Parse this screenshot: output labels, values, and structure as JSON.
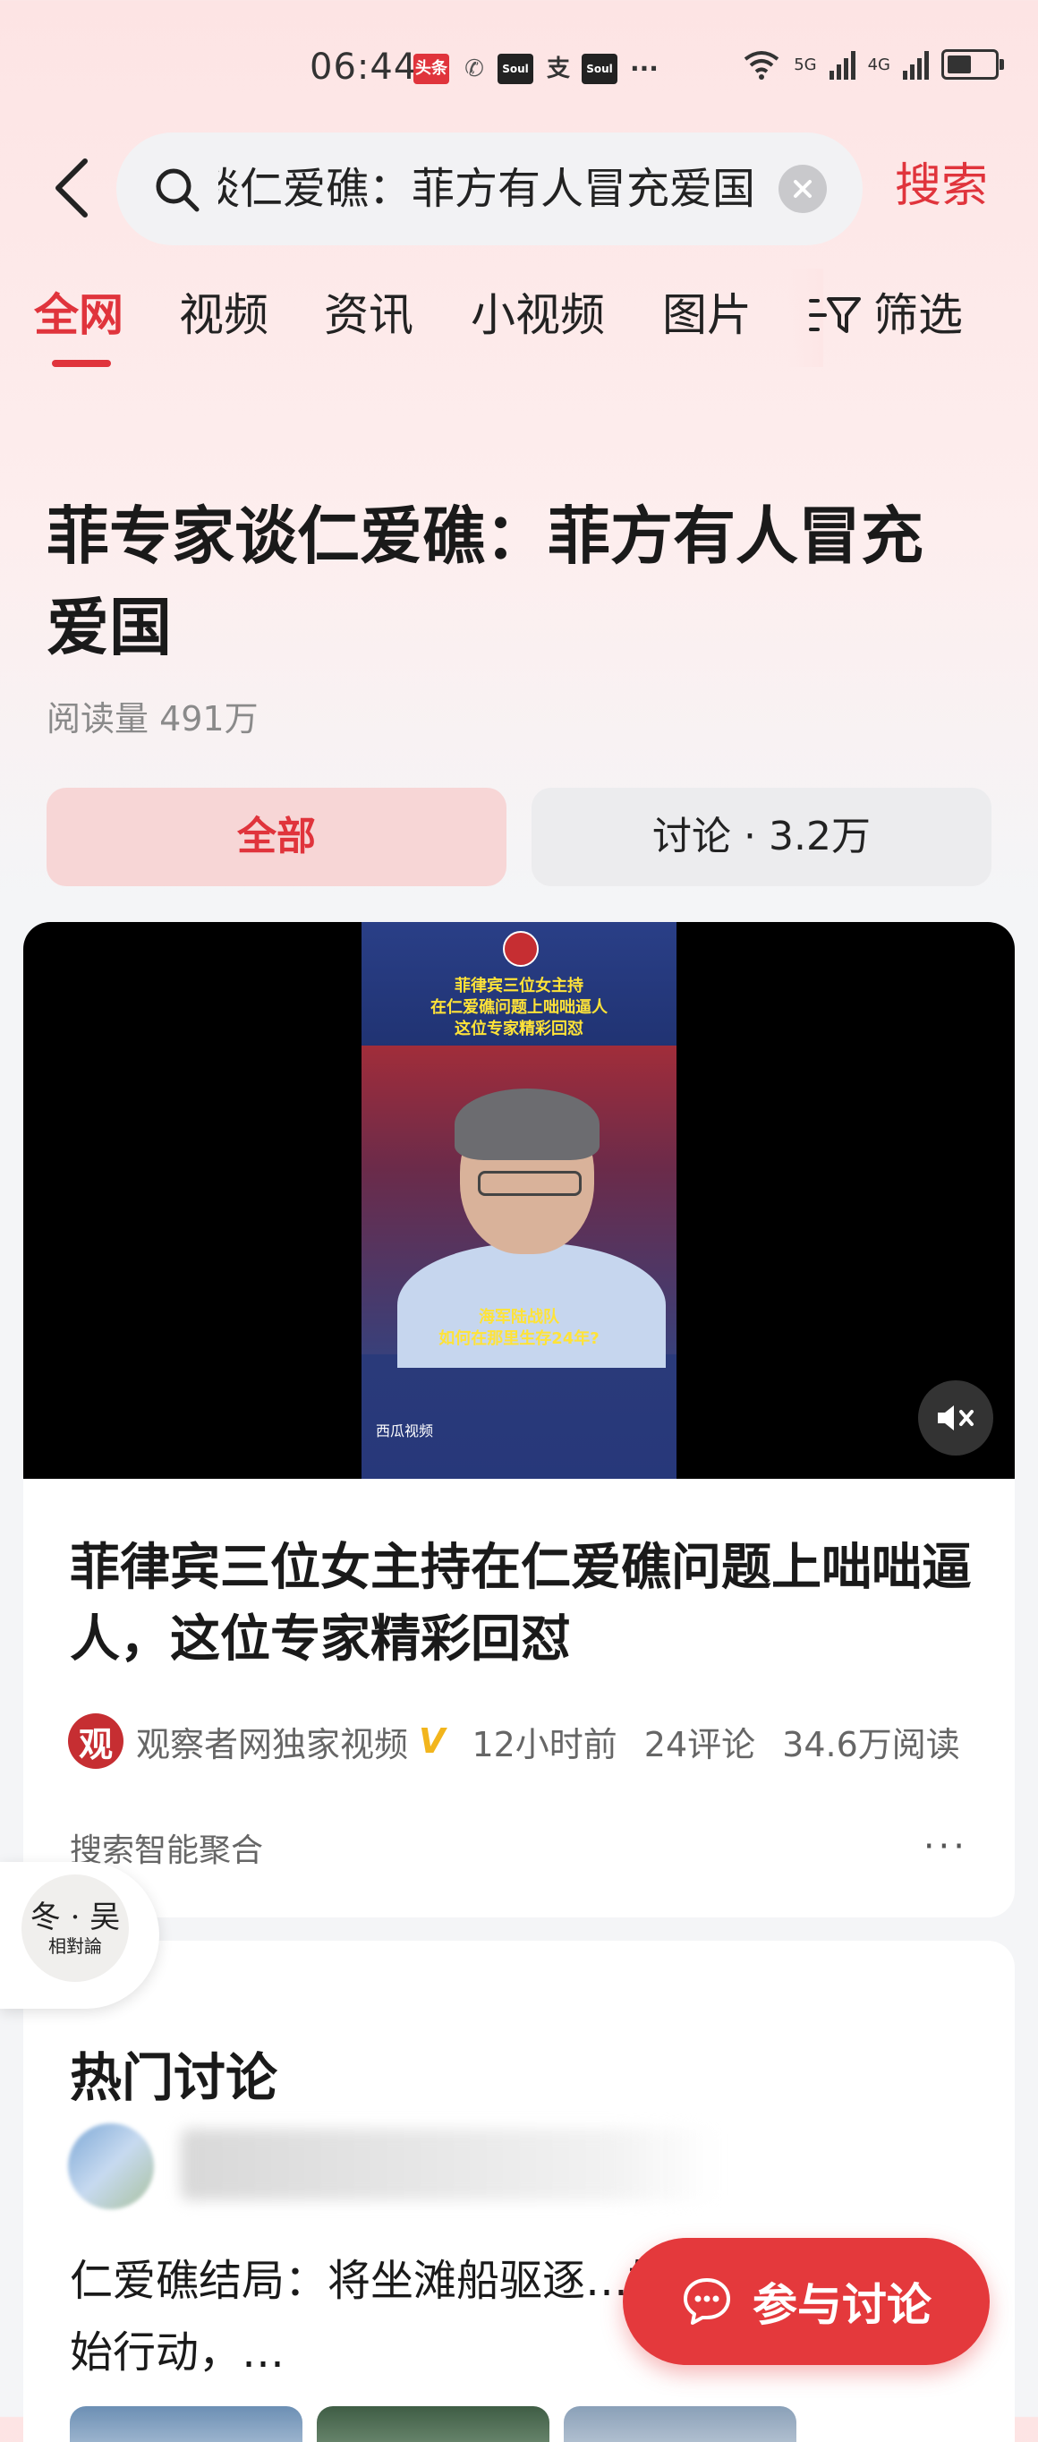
{
  "status_bar": {
    "time": "06:44",
    "apps": [
      "头条",
      "Soul",
      "支",
      "Soul"
    ],
    "more": "···",
    "network_1": "5G",
    "network_2": "4G"
  },
  "search": {
    "query": "菲专家谈仁爱礁：菲方有人冒充爱国",
    "search_label": "搜索"
  },
  "tabs": [
    {
      "label": "全网",
      "active": true
    },
    {
      "label": "视频"
    },
    {
      "label": "资讯"
    },
    {
      "label": "小视频"
    },
    {
      "label": "图片"
    }
  ],
  "filter_label": "筛选",
  "topic": {
    "title": "菲专家谈仁爱礁：菲方有人冒充爱国",
    "read_count": "阅读量 491万",
    "seg_all": "全部",
    "seg_discuss": "讨论 · 3.2万"
  },
  "video_card": {
    "video_caption_top": [
      "菲律宾三位女主持",
      "在仁爱礁问题上咄咄逼人",
      "这位专家精彩回怼"
    ],
    "video_caption_bottom": [
      "海军陆战队",
      "如何在那里生存24年?"
    ],
    "video_watermark": "西瓜视频",
    "title": "菲律宾三位女主持在仁爱礁问题上咄咄逼人，这位专家精彩回怼",
    "source_logo": "观",
    "source": "观察者网独家视频",
    "verified": "V",
    "time_ago": "12小时前",
    "comments": "24评论",
    "reads": "34.6万阅读",
    "aggregation": "搜索智能聚合",
    "more": "···"
  },
  "float_avatar": {
    "line1": "冬 · 吴",
    "line2": "相對論"
  },
  "hot_discussion": {
    "title": "热门讨论",
    "post_text": "仁爱礁结局：将坐滩船驱逐…始“种岛”，中方开始行动，…"
  },
  "fab": {
    "label": "参与讨论"
  },
  "colors": {
    "accent": "#e0343c",
    "bg_top": "#fde4e4",
    "bg_bottom": "#f4f5f7"
  }
}
